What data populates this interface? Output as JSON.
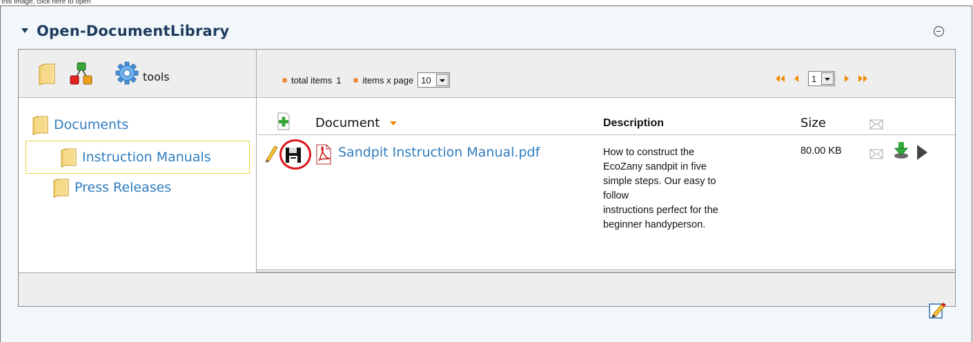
{
  "page_caption": "this image, click here to open",
  "portlet": {
    "title": "Open-DocumentLibrary"
  },
  "toolbar": {
    "tools_label": "tools"
  },
  "pager": {
    "total_items_label": "total items",
    "total_items_value": "1",
    "items_per_page_label": "items x page",
    "items_per_page_value": "10",
    "current_page": "1"
  },
  "tree": {
    "items": [
      {
        "label": "Documents",
        "selected": false
      },
      {
        "label": "Instruction Manuals",
        "selected": true
      },
      {
        "label": "Press Releases",
        "selected": false
      }
    ]
  },
  "table": {
    "headers": {
      "document": "Document",
      "description": "Description",
      "size": "Size"
    },
    "rows": [
      {
        "name": "Sandpit Instruction Manual.pdf",
        "description": "How to construct the\nEcoZany sandpit in five\nsimple steps. Our easy to\nfollow\ninstructions perfect for the\nbeginner handyperson.",
        "size": "80.00 KB"
      }
    ]
  },
  "colors": {
    "title": "#1e3c5e",
    "link": "#2e7cbf",
    "accent_orange": "#f28a00",
    "highlight_circle": "#e0151e",
    "selected_border": "#e5d33a"
  },
  "icons": {
    "folder": "folder-icon",
    "tree_structure": "tree-structure-icon",
    "gear": "gear-icon",
    "add": "add-document-icon",
    "sort": "sort-desc-icon",
    "mail": "mail-icon",
    "edit": "edit-pencil-icon",
    "save": "save-disk-icon",
    "pdf": "pdf-icon",
    "download": "download-icon",
    "play": "play-icon",
    "collapse": "collapse-icon",
    "edit_portlet": "edit-portlet-icon"
  }
}
